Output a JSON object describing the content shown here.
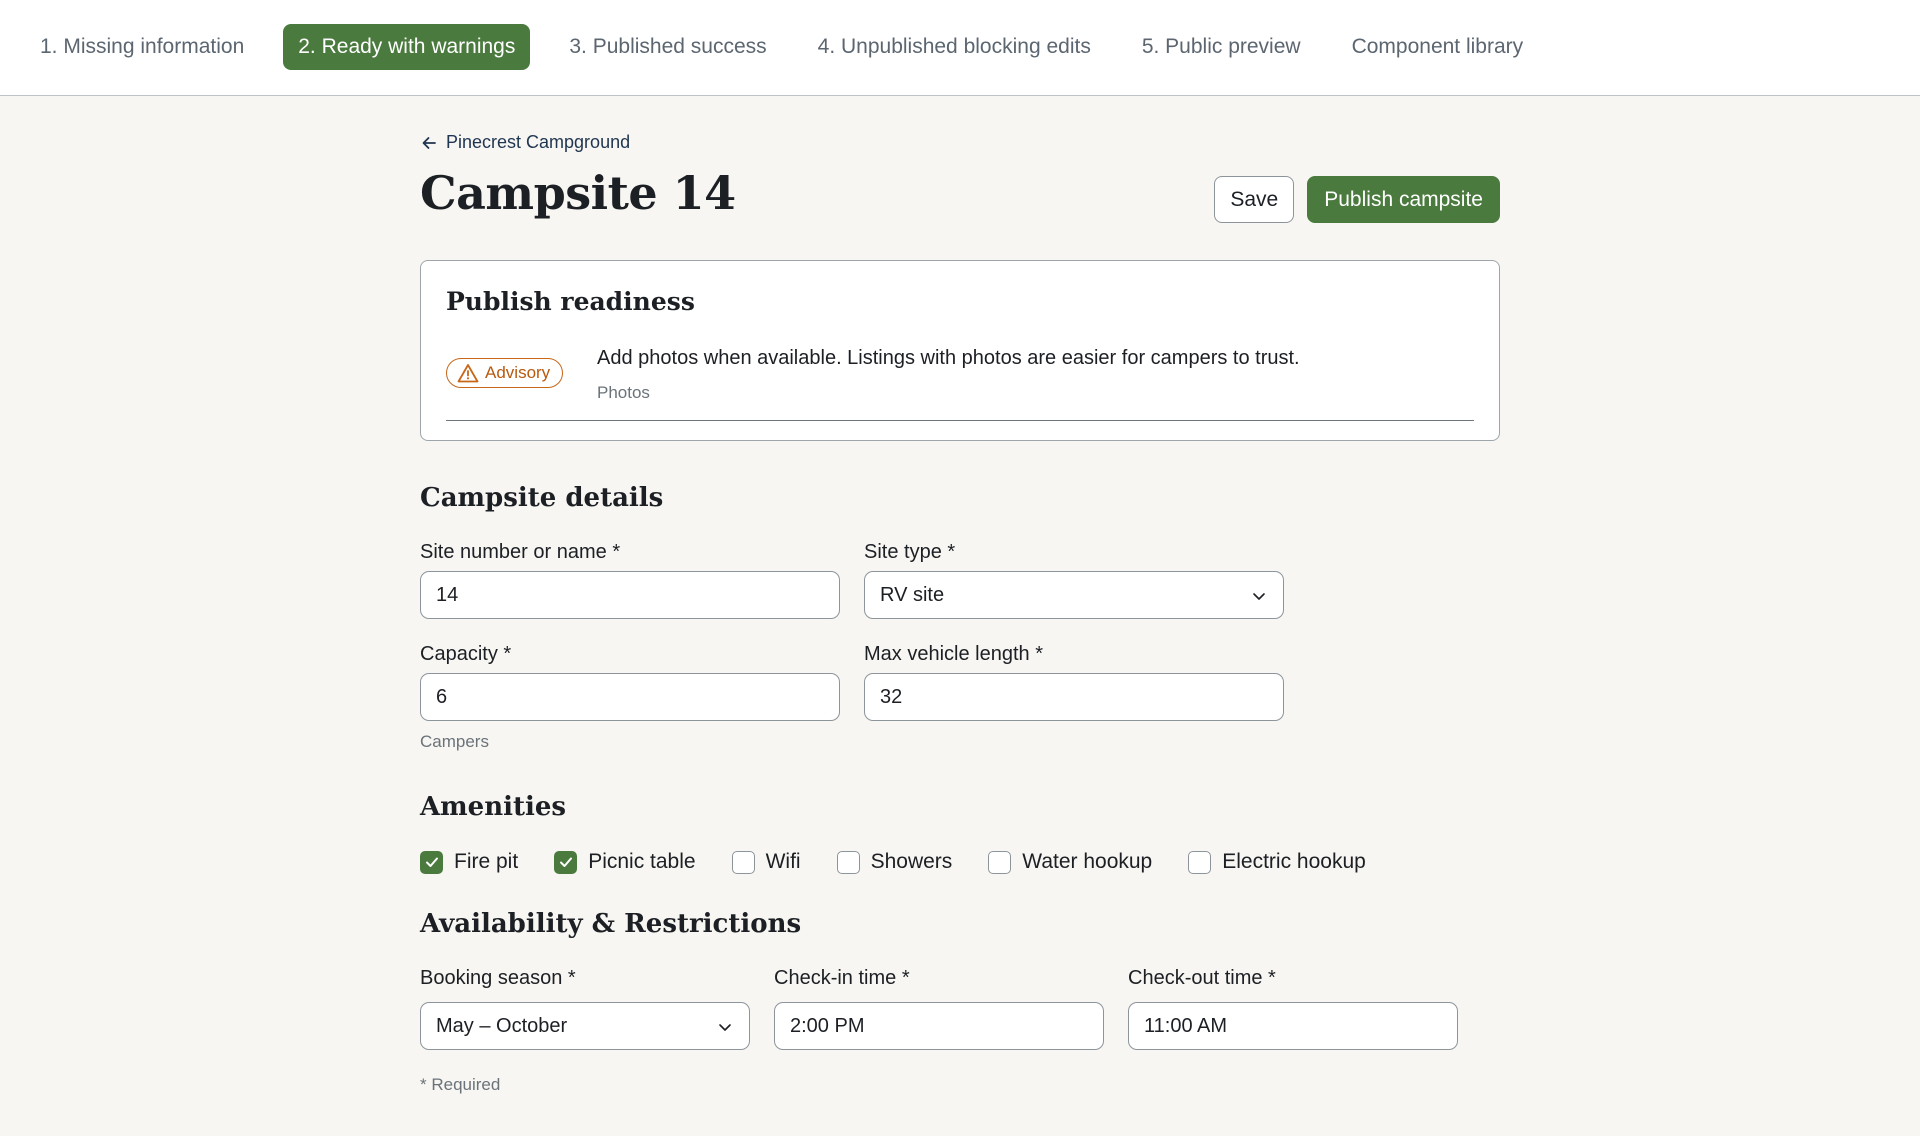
{
  "tabs": [
    {
      "label": "1. Missing information",
      "active": false
    },
    {
      "label": "2. Ready with warnings",
      "active": true
    },
    {
      "label": "3. Published success",
      "active": false
    },
    {
      "label": "4. Unpublished blocking edits",
      "active": false
    },
    {
      "label": "5. Public preview",
      "active": false
    },
    {
      "label": "Component library",
      "active": false
    }
  ],
  "breadcrumb": {
    "label": "Pinecrest Campground",
    "icon": "arrow-left-icon"
  },
  "page_title": "Campsite 14",
  "actions": {
    "save_label": "Save",
    "publish_label": "Publish campsite"
  },
  "readiness": {
    "title": "Publish readiness",
    "badge": {
      "label": "Advisory",
      "icon": "warning-triangle-icon",
      "color": "#c7671a"
    },
    "message": "Add photos when available. Listings with photos are easier for campers to trust.",
    "field": "Photos"
  },
  "details": {
    "title": "Campsite details",
    "site_name": {
      "label": "Site number or name *",
      "value": "14"
    },
    "site_type": {
      "label": "Site type *",
      "value": "RV site"
    },
    "capacity": {
      "label": "Capacity *",
      "value": "6",
      "hint": "Campers"
    },
    "max_vehicle": {
      "label": "Max vehicle length *",
      "value": "32"
    }
  },
  "amenities": {
    "title": "Amenities",
    "items": [
      {
        "label": "Fire pit",
        "checked": true
      },
      {
        "label": "Picnic table",
        "checked": true
      },
      {
        "label": "Wifi",
        "checked": false
      },
      {
        "label": "Showers",
        "checked": false
      },
      {
        "label": "Water hookup",
        "checked": false
      },
      {
        "label": "Electric hookup",
        "checked": false
      }
    ]
  },
  "availability": {
    "title": "Availability & Restrictions",
    "season": {
      "label": "Booking season *",
      "value": "May – October"
    },
    "checkin": {
      "label": "Check-in time *",
      "value": "2:00 PM"
    },
    "checkout": {
      "label": "Check-out time *",
      "value": "11:00 AM"
    },
    "required_note": "* Required"
  },
  "colors": {
    "accent": "#4a7a3e",
    "warning": "#c7671a",
    "background": "#f7f6f2"
  }
}
